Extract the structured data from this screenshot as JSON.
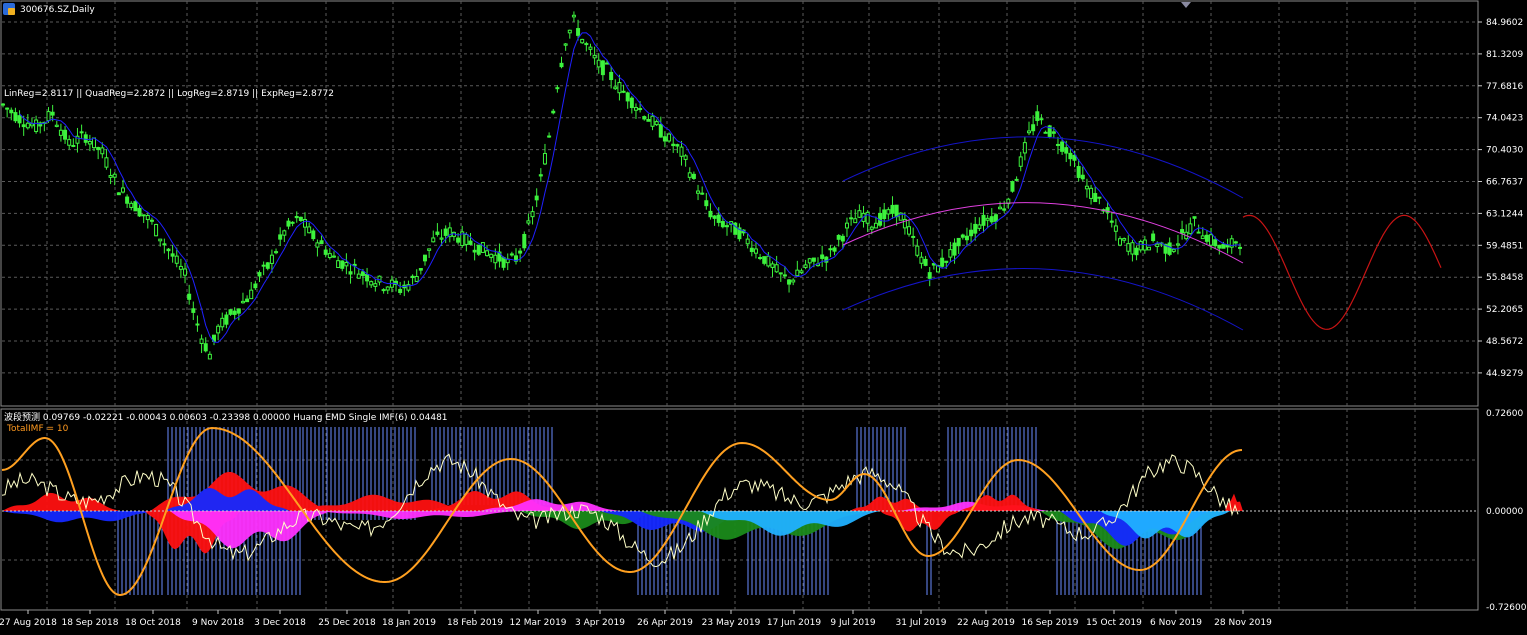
{
  "window": {
    "symbol_title": "300676.SZ,Daily",
    "regression_label": "LinReg=2.8117 || QuadReg=2.2872 || LogReg=2.8719 || ExpReg=2.8772",
    "indicator_label": "波段预测 0.09769 -0.02221 -0.00043 0.00603 -0.23398 0.00000 Huang EMD Single IMF(6) 0.04481",
    "total_imf_label": "TotalIMF = 10"
  },
  "colors": {
    "background": "#000000",
    "grid": "#5a5a5a",
    "candle": "#3df23d",
    "ma_line": "#2020ff",
    "channel": "#1414c8",
    "mid_curve": "#e040e0",
    "forecast": "#c81414",
    "imf_orange": "#ffa020",
    "imf_white": "#ffffc8",
    "hist_blue": "#6a8cff",
    "area_red": "#ff1010",
    "area_blue": "#1428ff",
    "area_magenta": "#ff30ff",
    "area_green": "#1a8a1a",
    "area_cyan": "#20b0ff"
  },
  "price_axis": [
    "84.9602",
    "81.3209",
    "77.6816",
    "74.0423",
    "70.4030",
    "66.7637",
    "63.1244",
    "59.4851",
    "55.8458",
    "52.2065",
    "48.5672",
    "44.9279"
  ],
  "indicator_axis": [
    "0.72600",
    "0.00000",
    "-0.72600"
  ],
  "time_axis": [
    "27 Aug 2018",
    "18 Sep 2018",
    "18 Oct 2018",
    "9 Nov 2018",
    "3 Dec 2018",
    "25 Dec 2018",
    "18 Jan 2019",
    "18 Feb 2019",
    "12 Mar 2019",
    "3 Apr 2019",
    "26 Apr 2019",
    "23 May 2019",
    "17 Jun 2019",
    "9 Jul 2019",
    "31 Jul 2019",
    "22 Aug 2019",
    "16 Sep 2019",
    "15 Oct 2019",
    "6 Nov 2019",
    "28 Nov 2019"
  ],
  "chart_data": {
    "type": "candlestick",
    "series": [
      {
        "values": [
          [
            0,
            75.5
          ],
          [
            4,
            74
          ],
          [
            8,
            73
          ],
          [
            12,
            74.5
          ],
          [
            16,
            71
          ],
          [
            20,
            72
          ],
          [
            24,
            70
          ],
          [
            28,
            66
          ],
          [
            32,
            64
          ],
          [
            36,
            62
          ],
          [
            40,
            59
          ],
          [
            44,
            56
          ],
          [
            46,
            52
          ],
          [
            48,
            49
          ],
          [
            50,
            47
          ],
          [
            52,
            50
          ],
          [
            54,
            51
          ],
          [
            56,
            52
          ],
          [
            58,
            53
          ],
          [
            60,
            54
          ],
          [
            62,
            56
          ],
          [
            64,
            57
          ],
          [
            66,
            59
          ],
          [
            68,
            61
          ],
          [
            70,
            62
          ],
          [
            72,
            62.5
          ],
          [
            74,
            61
          ],
          [
            76,
            60
          ],
          [
            78,
            59
          ],
          [
            80,
            58
          ],
          [
            82,
            57.5
          ],
          [
            84,
            57
          ],
          [
            86,
            56.5
          ],
          [
            88,
            56
          ],
          [
            90,
            55.5
          ],
          [
            92,
            55
          ],
          [
            94,
            55
          ],
          [
            96,
            54.5
          ],
          [
            98,
            55
          ],
          [
            100,
            56
          ],
          [
            102,
            58
          ],
          [
            104,
            60
          ],
          [
            106,
            60.5
          ],
          [
            108,
            61
          ],
          [
            110,
            60.5
          ],
          [
            112,
            60
          ],
          [
            114,
            59.5
          ],
          [
            116,
            59
          ],
          [
            118,
            58.5
          ],
          [
            120,
            58
          ],
          [
            122,
            57.5
          ],
          [
            124,
            58
          ],
          [
            126,
            60
          ],
          [
            128,
            63
          ],
          [
            130,
            67
          ],
          [
            132,
            72
          ],
          [
            134,
            78
          ],
          [
            136,
            83
          ],
          [
            138,
            85
          ],
          [
            140,
            83
          ],
          [
            142,
            81.5
          ],
          [
            144,
            80
          ],
          [
            146,
            79.5
          ],
          [
            148,
            78
          ],
          [
            150,
            77
          ],
          [
            152,
            76
          ],
          [
            154,
            75
          ],
          [
            156,
            74
          ],
          [
            158,
            73
          ],
          [
            160,
            72
          ],
          [
            162,
            71
          ],
          [
            164,
            70
          ],
          [
            166,
            68
          ],
          [
            168,
            66
          ],
          [
            170,
            64
          ],
          [
            172,
            62.5
          ],
          [
            174,
            62
          ],
          [
            176,
            61.5
          ],
          [
            178,
            61
          ],
          [
            180,
            60
          ],
          [
            182,
            59
          ],
          [
            184,
            58
          ],
          [
            186,
            57
          ],
          [
            188,
            56
          ],
          [
            190,
            55.5
          ],
          [
            192,
            56
          ],
          [
            194,
            57
          ],
          [
            196,
            57.5
          ],
          [
            198,
            58
          ],
          [
            200,
            58.5
          ],
          [
            202,
            60
          ],
          [
            204,
            61.5
          ],
          [
            206,
            62.5
          ],
          [
            208,
            63
          ],
          [
            210,
            62
          ],
          [
            212,
            62.5
          ],
          [
            214,
            63
          ],
          [
            216,
            63.5
          ],
          [
            218,
            62
          ],
          [
            220,
            60
          ],
          [
            222,
            58
          ],
          [
            224,
            56.5
          ],
          [
            226,
            57
          ],
          [
            228,
            58
          ],
          [
            230,
            59
          ],
          [
            232,
            60
          ],
          [
            234,
            61
          ],
          [
            236,
            62
          ],
          [
            238,
            62.5
          ],
          [
            240,
            63
          ],
          [
            242,
            64
          ],
          [
            244,
            66
          ],
          [
            246,
            69
          ],
          [
            248,
            72
          ],
          [
            250,
            74
          ],
          [
            252,
            73
          ],
          [
            254,
            72
          ],
          [
            256,
            71
          ],
          [
            258,
            70
          ],
          [
            260,
            68
          ],
          [
            262,
            66
          ],
          [
            264,
            65
          ],
          [
            266,
            64
          ],
          [
            268,
            62
          ],
          [
            270,
            60
          ],
          [
            272,
            59.5
          ],
          [
            274,
            59
          ],
          [
            276,
            59.5
          ],
          [
            278,
            60
          ],
          [
            280,
            59.5
          ],
          [
            282,
            59
          ],
          [
            284,
            60
          ],
          [
            286,
            61
          ],
          [
            288,
            62
          ],
          [
            290,
            61
          ],
          [
            292,
            60
          ],
          [
            294,
            59.5
          ],
          [
            296,
            59
          ],
          [
            298,
            60
          ]
        ]
      }
    ],
    "projection_value_range": [
      49.9,
      62.9
    ]
  }
}
